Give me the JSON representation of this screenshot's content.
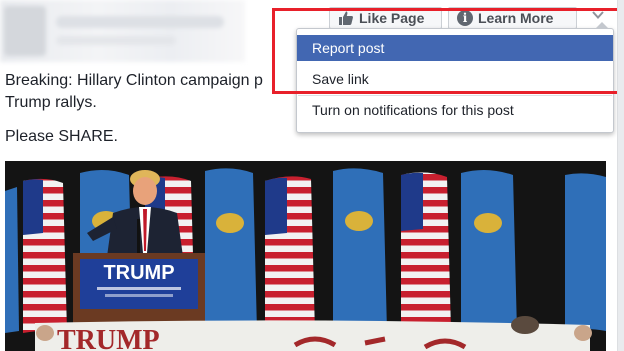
{
  "header": {
    "like_page_label": "Like Page",
    "learn_more_label": "Learn More",
    "like_icon": "thumbs-up-icon",
    "info_icon": "info-icon",
    "menu_icon": "chevron-down-icon"
  },
  "post": {
    "text_line1": "Breaking: Hillary Clinton campaign p",
    "text_line2": "Trump rallys.",
    "share_text": "Please SHARE."
  },
  "menu": {
    "items": [
      {
        "label": "Report post",
        "state": "highlighted"
      },
      {
        "label": "Save link"
      },
      {
        "label": "Turn on notifications for this post"
      }
    ]
  },
  "photo": {
    "podium_sign": "TRUMP",
    "banner_text": "TRUMP"
  },
  "colors": {
    "menu_highlight": "#4267b2",
    "annotation_box": "#e8202a",
    "button_text": "#4b4f56"
  }
}
